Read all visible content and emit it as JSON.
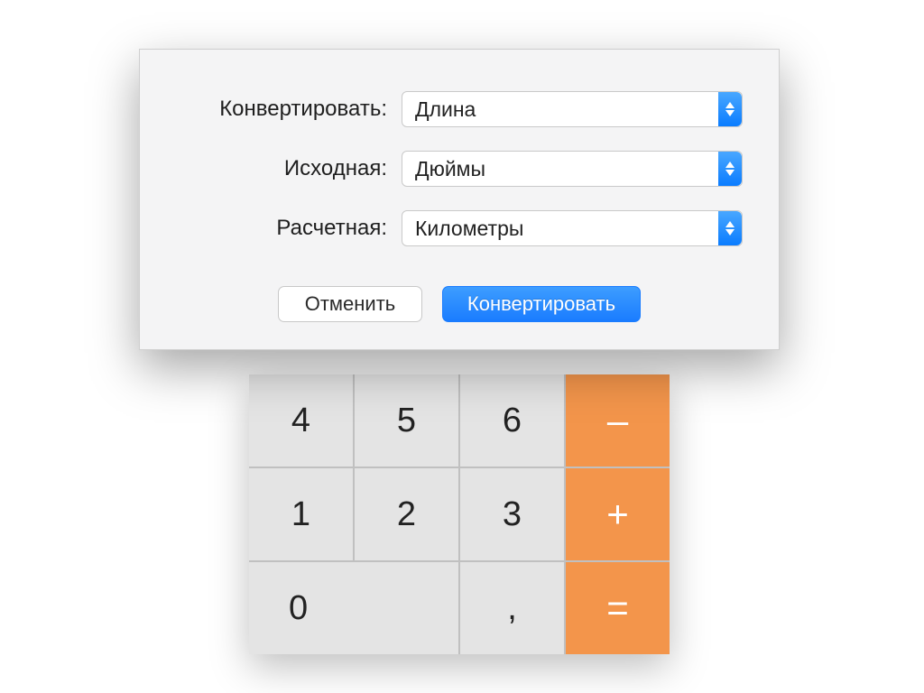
{
  "dialog": {
    "labels": {
      "convert": "Конвертировать:",
      "from": "Исходная:",
      "to": "Расчетная:"
    },
    "selects": {
      "convert": "Длина",
      "from": "Дюймы",
      "to": "Километры"
    },
    "buttons": {
      "cancel": "Отменить",
      "submit": "Конвертировать"
    }
  },
  "keypad": {
    "k4": "4",
    "k5": "5",
    "k6": "6",
    "minus": "–",
    "k1": "1",
    "k2": "2",
    "k3": "3",
    "plus": "+",
    "k0": "0",
    "decimal": ",",
    "equals": "="
  }
}
